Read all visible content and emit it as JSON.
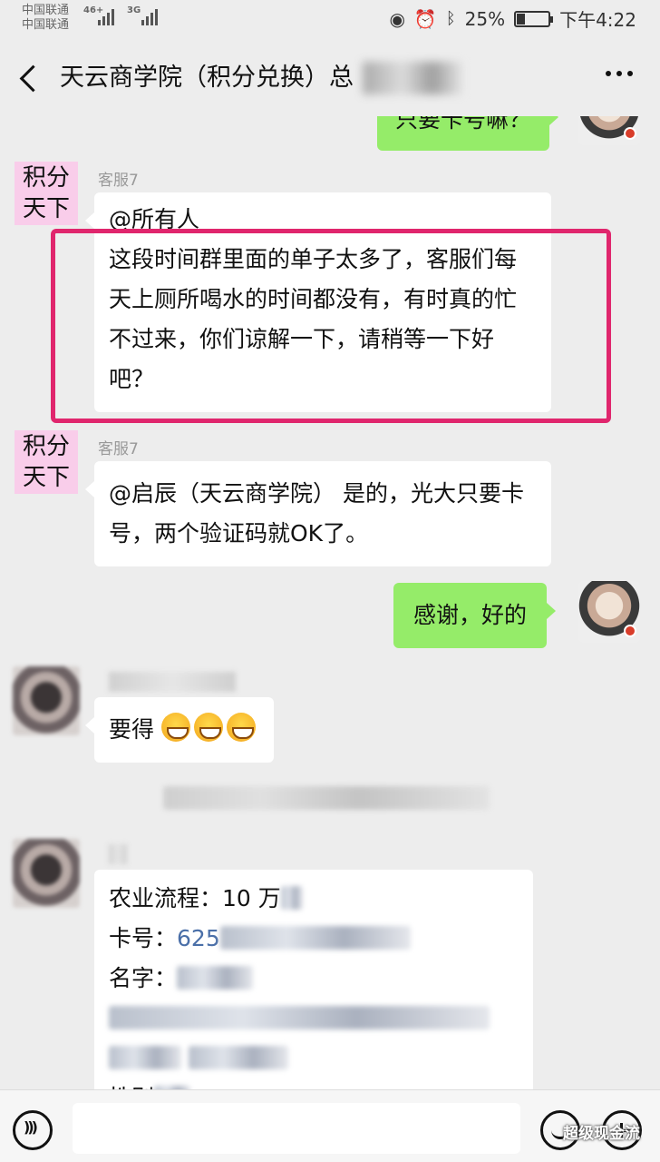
{
  "status_bar": {
    "carrier_1": "中国联通",
    "carrier_2": "中国联通",
    "net_1": "46+",
    "net_2": "3G",
    "battery": "25%",
    "battery_level": 0.25,
    "time": "下午4:22"
  },
  "header": {
    "title": "天云商学院（积分兑换）总",
    "more_icon": "more-dots-icon"
  },
  "messages": {
    "top_partial": "只要卡号嘛？",
    "msg1": {
      "avatar_text_1": "积分",
      "avatar_text_2": "天下",
      "sender": "客服7",
      "mention": "@所有人",
      "body": "这段时间群里面的单子太多了，客服们每天上厕所喝水的时间都没有，有时真的忙不过来，你们谅解一下，请稍等一下好吧？"
    },
    "msg2": {
      "avatar_text_1": "积分",
      "avatar_text_2": "天下",
      "sender": "客服7",
      "body": "@启辰（天云商学院） 是的，光大只要卡号，两个验证码就OK了。"
    },
    "msg3": {
      "body": "感谢，好的"
    },
    "msg4": {
      "body": "要得"
    },
    "msg5": {
      "line1_label": "农业流程：",
      "line1_value": "10 万",
      "line2_label": "卡号：",
      "line2_value": "625",
      "line3_label": "名字：",
      "line6_label": "性别"
    }
  },
  "footer": {
    "watermark": "超级现金流"
  },
  "colors": {
    "highlight": "#e0266d",
    "my_bubble": "#95ec69",
    "avatar_pink": "#f9cdea"
  }
}
